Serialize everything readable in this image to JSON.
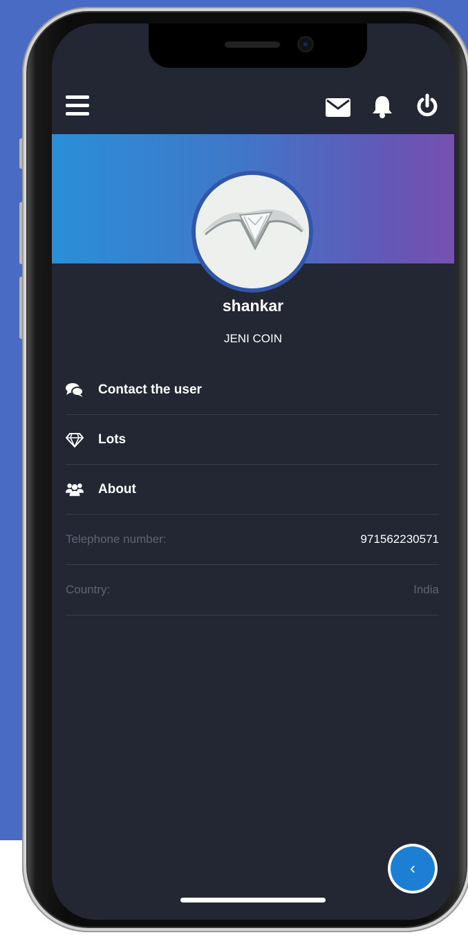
{
  "header": {
    "menu_icon": "hamburger-menu-icon",
    "mail_icon": "envelope-icon",
    "notification_icon": "bell-icon",
    "power_icon": "power-icon"
  },
  "profile": {
    "avatar": "diamond-ring-photo",
    "name": "shankar",
    "company": "JENI COIN"
  },
  "menu": {
    "items": [
      {
        "label": "Contact the user",
        "icon": "chat-bubbles-icon"
      },
      {
        "label": "Lots",
        "icon": "diamond-icon"
      },
      {
        "label": "About",
        "icon": "users-group-icon"
      }
    ]
  },
  "details": [
    {
      "label": "Telephone number:",
      "value": "971562230571"
    },
    {
      "label": "Country:",
      "value": "India"
    }
  ],
  "fab": {
    "icon": "chevron-left-icon",
    "glyph": "‹"
  },
  "colors": {
    "background": "#4a6bc3",
    "screen": "#232734",
    "banner_start": "#2a8fd8",
    "banner_end": "#7751b0",
    "accent": "#1d7fd4"
  }
}
